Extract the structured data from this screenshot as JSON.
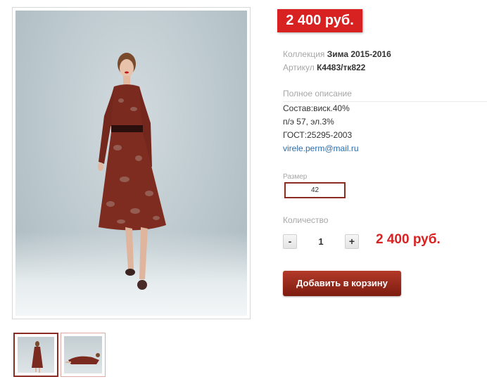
{
  "product": {
    "price_badge": "2 400 руб.",
    "collection_label": "Коллекция",
    "collection_value": "Зима 2015-2016",
    "sku_label": "Артикул",
    "sku_value": "К4483/тк822"
  },
  "description": {
    "title": "Полное описание",
    "lines": [
      "Состав:виск.40%",
      "п/э 57, эл.3%",
      "ГОСТ:25295-2003"
    ],
    "email": "virele.perm@mail.ru"
  },
  "size": {
    "label": "Размер",
    "selected": "42"
  },
  "quantity": {
    "label": "Количество",
    "minus": "-",
    "value": "1",
    "plus": "+",
    "total": "2 400 руб."
  },
  "cart": {
    "button_label": "Добавить в корзину"
  },
  "gallery": {
    "thumbnails": 2,
    "active_index": 0
  },
  "colors": {
    "price_red": "#d82222",
    "accent_dark_red": "#8b2b22",
    "link_blue": "#2b6cab"
  }
}
